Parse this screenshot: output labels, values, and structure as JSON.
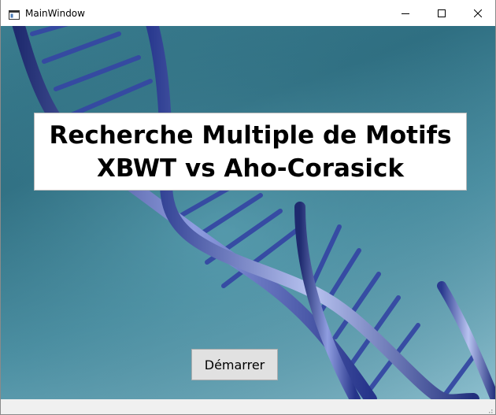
{
  "window": {
    "title": "MainWindow",
    "icon": "window-app-icon",
    "controls": {
      "minimize_icon": "minimize-icon",
      "maximize_icon": "maximize-icon",
      "close_icon": "close-icon"
    }
  },
  "main": {
    "background": "dna-helix-image",
    "heading": {
      "line1": "Recherche Multiple de Motifs",
      "line2": "XBWT vs Aho-Corasick"
    },
    "start_button_label": "Démarrer"
  },
  "statusbar": {
    "grip_icon": "size-grip-icon"
  },
  "colors": {
    "background_teal": "#3a7d8f",
    "helix_blue": "#3d4fa8",
    "button_face": "#e1e1e1"
  }
}
